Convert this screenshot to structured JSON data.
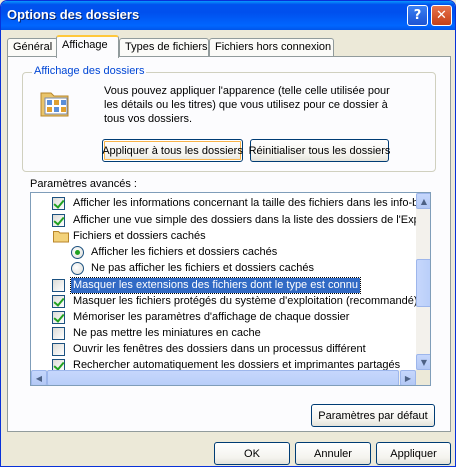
{
  "window": {
    "title": "Options des dossiers",
    "help_symbol": "?",
    "close_symbol": "✕"
  },
  "tabs": [
    {
      "label": "Général"
    },
    {
      "label": "Affichage",
      "active": true
    },
    {
      "label": "Types de fichiers"
    },
    {
      "label": "Fichiers hors connexion"
    }
  ],
  "folder_view": {
    "legend": "Affichage des dossiers",
    "description": "Vous pouvez appliquer l'apparence (telle celle utilisée pour les détails ou les titres) que vous utilisez pour ce dossier à tous vos dossiers.",
    "apply_all_label": "Appliquer à tous les dossiers",
    "reset_all_label": "Réinitialiser tous les dossiers"
  },
  "advanced": {
    "label": "Paramètres avancés :",
    "items": [
      {
        "type": "checkbox",
        "checked": true,
        "text": "Afficher les informations concernant la taille des fichiers dans les info-bulles"
      },
      {
        "type": "checkbox",
        "checked": true,
        "text": "Afficher une vue simple des dossiers dans la liste des dossiers de l'Explorateur"
      },
      {
        "type": "folder",
        "text": "Fichiers et dossiers cachés"
      },
      {
        "type": "radio",
        "checked": true,
        "text": "Afficher les fichiers et dossiers cachés"
      },
      {
        "type": "radio",
        "checked": false,
        "text": "Ne pas afficher les fichiers et dossiers cachés"
      },
      {
        "type": "checkbox",
        "checked": false,
        "selected": true,
        "text": "Masquer les extensions des fichiers dont le type est connu"
      },
      {
        "type": "checkbox",
        "checked": true,
        "text": "Masquer les fichiers protégés du système d'exploitation (recommandé)"
      },
      {
        "type": "checkbox",
        "checked": true,
        "text": "Mémoriser les paramètres d'affichage de chaque dossier"
      },
      {
        "type": "checkbox",
        "checked": false,
        "text": "Ne pas mettre les miniatures en cache"
      },
      {
        "type": "checkbox",
        "checked": false,
        "text": "Ouvrir les fenêtres des dossiers dans un processus différent"
      },
      {
        "type": "checkbox",
        "checked": true,
        "text": "Rechercher automatiquement les dossiers et imprimantes partagés"
      }
    ],
    "defaults_label": "Paramètres par défaut"
  },
  "footer": {
    "ok_label": "OK",
    "cancel_label": "Annuler",
    "apply_label": "Appliquer"
  },
  "colors": {
    "titlebar": "#0054e3",
    "selection": "#316ac5",
    "check": "#21a121",
    "tab_highlight": "#ffc83c"
  }
}
